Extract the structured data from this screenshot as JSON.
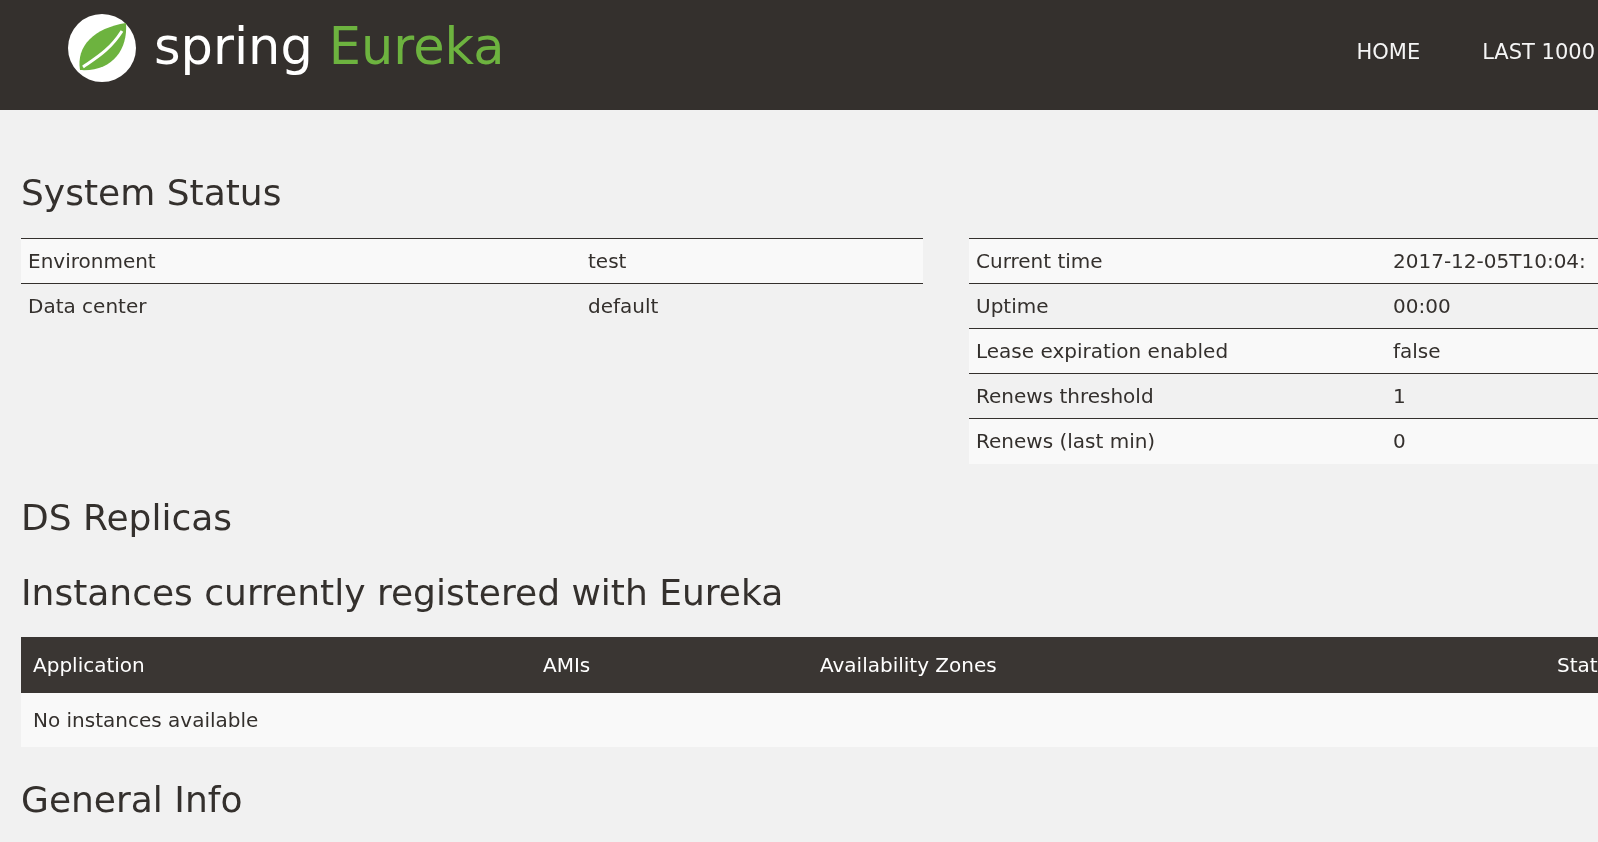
{
  "header": {
    "logo": {
      "brand": "spring",
      "product": "Eureka"
    },
    "nav": [
      "HOME",
      "LAST 1000"
    ]
  },
  "system_status": {
    "title": "System Status",
    "left_table": [
      {
        "label": "Environment",
        "value": "test"
      },
      {
        "label": "Data center",
        "value": "default"
      }
    ],
    "right_table": [
      {
        "label": "Current time",
        "value": "2017-12-05T10:04:"
      },
      {
        "label": "Uptime",
        "value": "00:00"
      },
      {
        "label": "Lease expiration enabled",
        "value": "false"
      },
      {
        "label": "Renews threshold",
        "value": "1"
      },
      {
        "label": "Renews (last min)",
        "value": "0"
      }
    ]
  },
  "ds_replicas": {
    "title": "DS Replicas"
  },
  "instances": {
    "title": "Instances currently registered with Eureka",
    "columns": [
      "Application",
      "AMIs",
      "Availability Zones",
      "Stat"
    ],
    "empty_message": "No instances available"
  },
  "general_info": {
    "title": "General Info"
  }
}
